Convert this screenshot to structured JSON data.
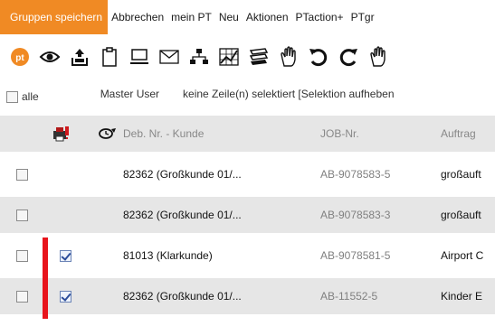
{
  "menu": {
    "items": [
      "Gruppen speichern",
      "Abbrechen",
      "mein PT",
      "Neu",
      "Aktionen",
      "PTaction+",
      "PTgr"
    ],
    "accent": "#f08a24"
  },
  "toolbar": {
    "icons": [
      "pt-logo-icon",
      "eye-icon",
      "inbox-upload-icon",
      "clipboard-icon",
      "monitor-icon",
      "envelope-icon",
      "network-icon",
      "chart-icon",
      "book-stack-icon",
      "hand-icon",
      "undo-icon",
      "redo-icon",
      "hand-stop-icon"
    ]
  },
  "selection": {
    "all_label": "alle",
    "master_label": "Master User",
    "status_text": "keine Zeile(n) selektiert [Selektion aufheben"
  },
  "table": {
    "columns": {
      "customer": "Deb. Nr. - Kunde",
      "job": "JOB-Nr.",
      "order": "Auftrag"
    },
    "header_icons": [
      "printer-alert-icon",
      "clock-refresh-icon"
    ],
    "flag_color": "#e8141c",
    "rows": [
      {
        "customer": "82362 (Großkunde 01/...",
        "job": "AB-9078583-5",
        "order": "großauft",
        "flagged": false,
        "checked": false
      },
      {
        "customer": "82362 (Großkunde 01/...",
        "job": "AB-9078583-3",
        "order": "großauft",
        "flagged": false,
        "checked": false
      },
      {
        "customer": "81013 (Klarkunde)",
        "job": "AB-9078581-5",
        "order": "Airport C",
        "flagged": true,
        "checked": true
      },
      {
        "customer": "82362 (Großkunde 01/...",
        "job": "AB-11552-5",
        "order": "Kinder E",
        "flagged": true,
        "checked": true
      }
    ]
  }
}
